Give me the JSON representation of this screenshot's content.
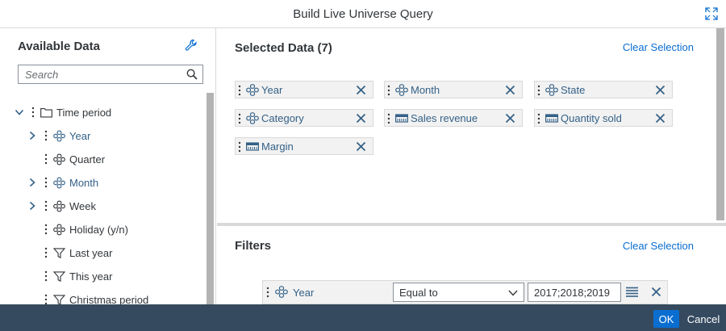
{
  "dialog": {
    "title": "Build Live Universe Query"
  },
  "colors": {
    "footer_bg": "#354a5f",
    "primary_button": "#0a6ed1",
    "link": "#0a6ed1",
    "dimension_text": "#346187"
  },
  "available": {
    "title": "Available Data",
    "search_placeholder": "Search",
    "tree": [
      {
        "label": "Time period",
        "icon": "folder-icon",
        "expander": "collapse",
        "level": 0,
        "highlight": false
      },
      {
        "label": "Year",
        "icon": "dimension-icon",
        "expander": "expand",
        "level": 1,
        "highlight": true
      },
      {
        "label": "Quarter",
        "icon": "dimension-icon",
        "expander": "none",
        "level": 1,
        "highlight": false
      },
      {
        "label": "Month",
        "icon": "dimension-icon",
        "expander": "expand",
        "level": 1,
        "highlight": true
      },
      {
        "label": "Week",
        "icon": "dimension-icon",
        "expander": "expand",
        "level": 1,
        "highlight": false
      },
      {
        "label": "Holiday (y/n)",
        "icon": "dimension-icon",
        "expander": "none",
        "level": 1,
        "highlight": false
      },
      {
        "label": "Last year",
        "icon": "filter-icon",
        "expander": "none",
        "level": 1,
        "highlight": false
      },
      {
        "label": "This year",
        "icon": "filter-icon",
        "expander": "none",
        "level": 1,
        "highlight": false
      },
      {
        "label": "Christmas period",
        "icon": "filter-icon",
        "expander": "none",
        "level": 1,
        "highlight": false
      }
    ]
  },
  "selected": {
    "title": "Selected Data (7)",
    "clear_label": "Clear Selection",
    "chips": [
      {
        "label": "Year",
        "icon": "dimension-icon"
      },
      {
        "label": "Month",
        "icon": "dimension-icon"
      },
      {
        "label": "State",
        "icon": "dimension-icon"
      },
      {
        "label": "Category",
        "icon": "dimension-icon"
      },
      {
        "label": "Sales revenue",
        "icon": "measure-icon"
      },
      {
        "label": "Quantity sold",
        "icon": "measure-icon"
      },
      {
        "label": "Margin",
        "icon": "measure-icon"
      }
    ]
  },
  "filters": {
    "title": "Filters",
    "clear_label": "Clear Selection",
    "rows": [
      {
        "field": "Year",
        "operator": "Equal to",
        "value": "2017;2018;2019"
      }
    ]
  },
  "footer": {
    "ok_label": "OK",
    "cancel_label": "Cancel"
  }
}
